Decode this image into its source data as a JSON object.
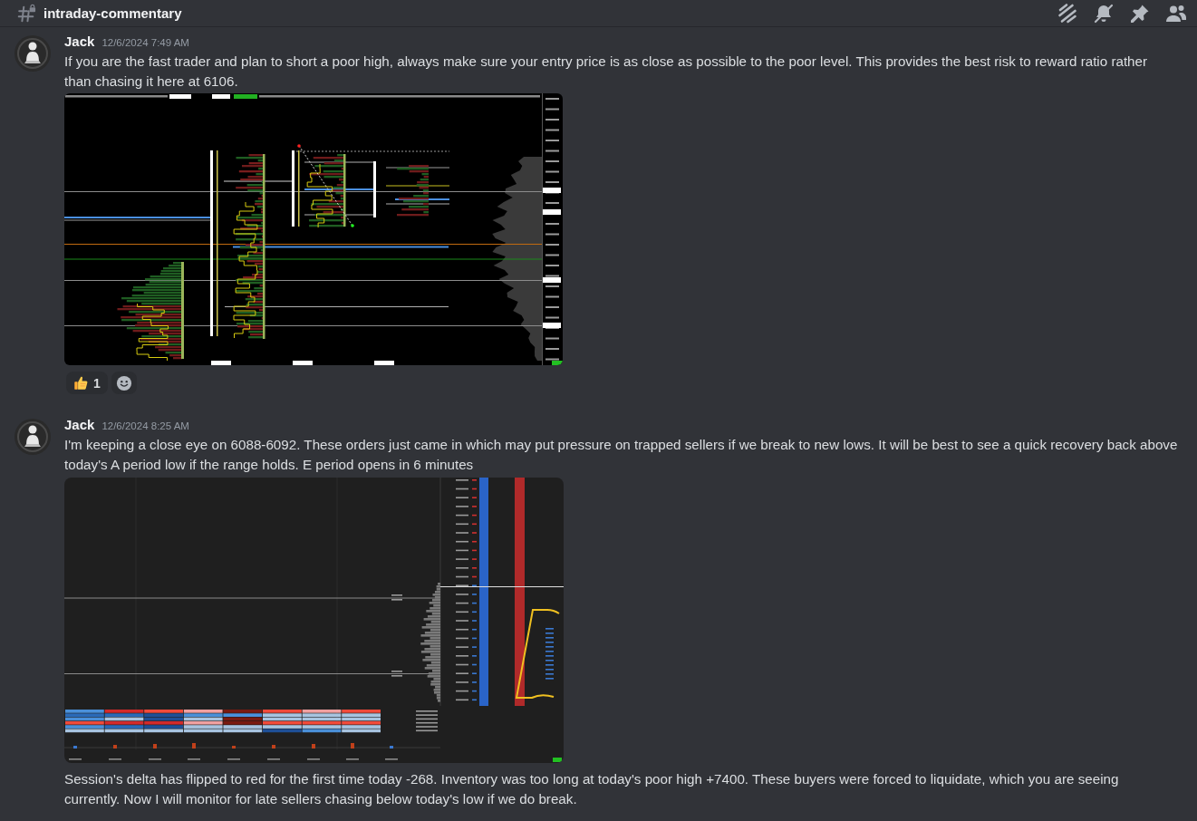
{
  "channel": {
    "name": "intraday-commentary"
  },
  "messages": [
    {
      "author": "Jack",
      "timestamp": "12/6/2024 7:49 AM",
      "blocks": [
        {
          "kind": "text",
          "text": "If you are the fast trader and plan to short a poor high, always make sure your entry price is as close as possible to the poor level. This provides the best risk to reward ratio rather than chasing it here at 6106."
        },
        {
          "kind": "profile"
        },
        {
          "kind": "reactions",
          "items": [
            {
              "count": "1",
              "selected": false
            }
          ]
        }
      ]
    },
    {
      "author": "Jack",
      "timestamp": "12/6/2024 8:25 AM",
      "blocks": [
        {
          "kind": "text",
          "text": "I'm keeping a close eye on 6088-6092. These orders just came in which may put pressure on trapped sellers if we break to new lows. It will be best to see a quick recovery back above today's A period low if the range holds. E period opens in 6 minutes"
        },
        {
          "kind": "orderflow"
        },
        {
          "kind": "text",
          "text": "Session's delta has flipped to red for the first time today -268. Inventory was too long at today's poor high +7400. These buyers were forced to liquidate, which you are seeing currently. Now I will monitor for late sellers chasing below today's low if we do break."
        }
      ]
    }
  ]
}
